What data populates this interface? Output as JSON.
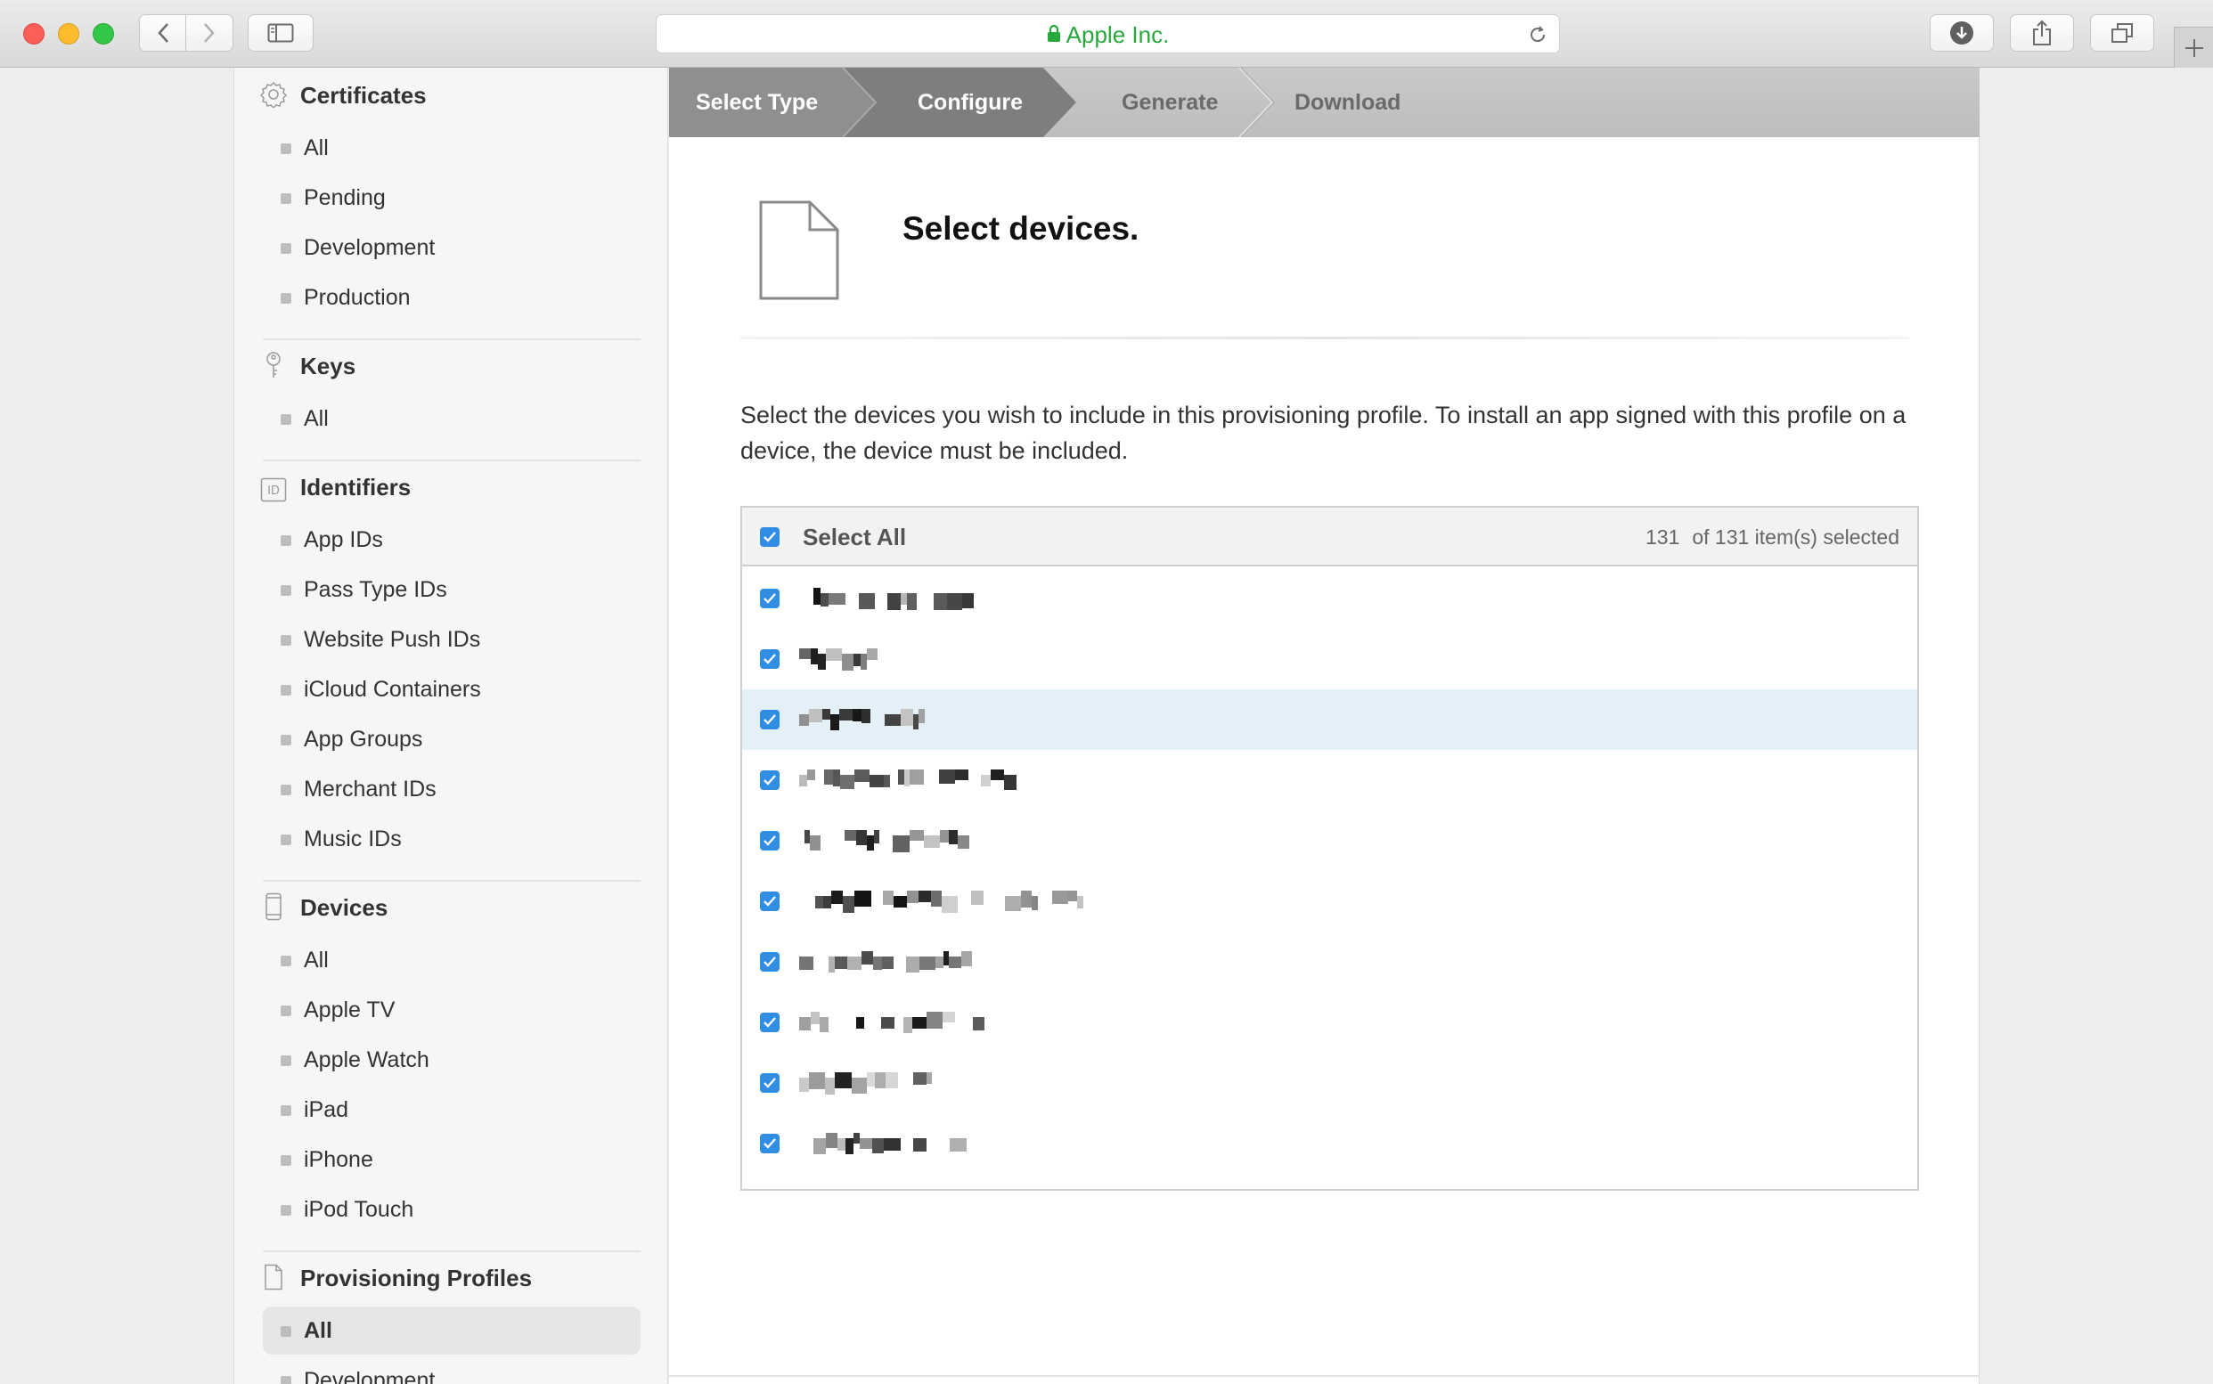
{
  "browser": {
    "address": "Apple Inc.",
    "colors": {
      "secure": "#27a83c"
    }
  },
  "sidebar": {
    "sections": [
      {
        "icon": "certificate-icon",
        "title": "Certificates",
        "items": [
          "All",
          "Pending",
          "Development",
          "Production"
        ]
      },
      {
        "icon": "key-icon",
        "title": "Keys",
        "items": [
          "All"
        ]
      },
      {
        "icon": "id-badge-icon",
        "title": "Identifiers",
        "items": [
          "App IDs",
          "Pass Type IDs",
          "Website Push IDs",
          "iCloud Containers",
          "App Groups",
          "Merchant IDs",
          "Music IDs"
        ]
      },
      {
        "icon": "device-icon",
        "title": "Devices",
        "items": [
          "All",
          "Apple TV",
          "Apple Watch",
          "iPad",
          "iPhone",
          "iPod Touch"
        ]
      },
      {
        "icon": "document-icon",
        "title": "Provisioning Profiles",
        "items": [
          "All",
          "Development"
        ],
        "active_item": "All"
      }
    ]
  },
  "steps": {
    "items": [
      "Select Type",
      "Configure",
      "Generate",
      "Download"
    ],
    "current": "Configure"
  },
  "main": {
    "title": "Select devices.",
    "description": "Select the devices you wish to include in this provisioning profile. To install an app signed with this profile on a device, the device must be included.",
    "list": {
      "select_all_label": "Select All",
      "selected_count": "131",
      "selected_suffix": "of 131 item(s) selected",
      "rows_checked": [
        true,
        true,
        true,
        true,
        true,
        true,
        true,
        true,
        true,
        true
      ],
      "highlighted_row": 3
    }
  }
}
